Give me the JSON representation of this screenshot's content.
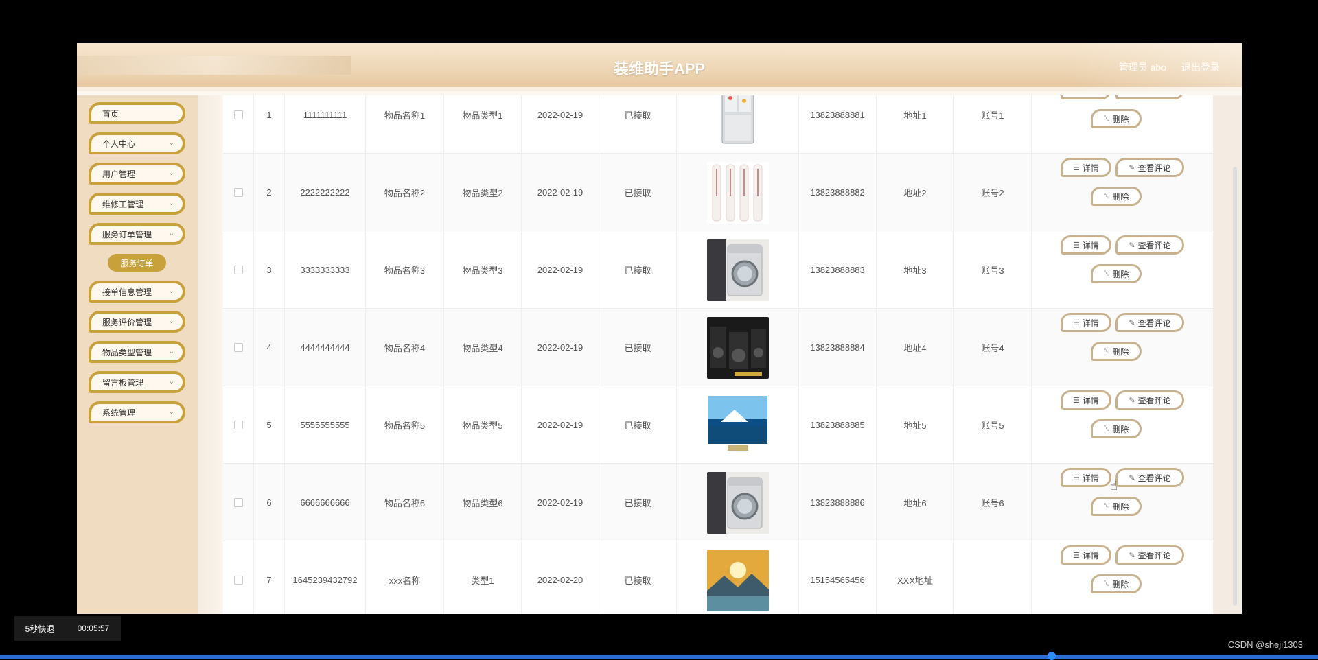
{
  "header": {
    "title": "装维助手APP",
    "admin": "管理员 abo",
    "logout": "退出登录"
  },
  "sidebar": {
    "items": [
      {
        "label": "首页",
        "expandable": false
      },
      {
        "label": "个人中心",
        "expandable": true
      },
      {
        "label": "用户管理",
        "expandable": true
      },
      {
        "label": "维修工管理",
        "expandable": true
      },
      {
        "label": "服务订单管理",
        "expandable": true
      },
      {
        "label": "接单信息管理",
        "expandable": true
      },
      {
        "label": "服务评价管理",
        "expandable": true
      },
      {
        "label": "物品类型管理",
        "expandable": true
      },
      {
        "label": "留言板管理",
        "expandable": true
      },
      {
        "label": "系统管理",
        "expandable": true
      }
    ],
    "active_sub": "服务订单"
  },
  "rows": [
    {
      "idx": "1",
      "no": "1111111111",
      "name": "物品名称1",
      "type": "物品类型1",
      "date": "2022-02-19",
      "status": "已接取",
      "phone": "13823888881",
      "addr": "地址1",
      "account": "账号1",
      "image": "fridge"
    },
    {
      "idx": "2",
      "no": "2222222222",
      "name": "物品名称2",
      "type": "物品类型2",
      "date": "2022-02-19",
      "status": "已接取",
      "phone": "13823888882",
      "addr": "地址2",
      "account": "账号2",
      "image": "tower-ac"
    },
    {
      "idx": "3",
      "no": "3333333333",
      "name": "物品名称3",
      "type": "物品类型3",
      "date": "2022-02-19",
      "status": "已接取",
      "phone": "13823888883",
      "addr": "地址3",
      "account": "账号3",
      "image": "washer"
    },
    {
      "idx": "4",
      "no": "4444444444",
      "name": "物品名称4",
      "type": "物品类型4",
      "date": "2022-02-19",
      "status": "已接取",
      "phone": "13823888884",
      "addr": "地址4",
      "account": "账号4",
      "image": "speakers"
    },
    {
      "idx": "5",
      "no": "5555555555",
      "name": "物品名称5",
      "type": "物品类型5",
      "date": "2022-02-19",
      "status": "已接取",
      "phone": "13823888885",
      "addr": "地址5",
      "account": "账号5",
      "image": "tv"
    },
    {
      "idx": "6",
      "no": "6666666666",
      "name": "物品名称6",
      "type": "物品类型6",
      "date": "2022-02-19",
      "status": "已接取",
      "phone": "13823888886",
      "addr": "地址6",
      "account": "账号6",
      "image": "washer"
    },
    {
      "idx": "7",
      "no": "1645239432792",
      "name": "xxx名称",
      "type": "类型1",
      "date": "2022-02-20",
      "status": "已接取",
      "phone": "15154565456",
      "addr": "XXX地址",
      "account": "",
      "image": "landscape"
    }
  ],
  "actions": {
    "detail": "详情",
    "review": "查看评论",
    "delete": "删除"
  },
  "player": {
    "skip": "5秒快退",
    "time": "00:05:57"
  },
  "watermark": "CSDN @sheji1303",
  "colors": {
    "accent": "#c9a13a",
    "sidebar_bg": "#f0dcc0",
    "button_border": "#c8b28e"
  }
}
